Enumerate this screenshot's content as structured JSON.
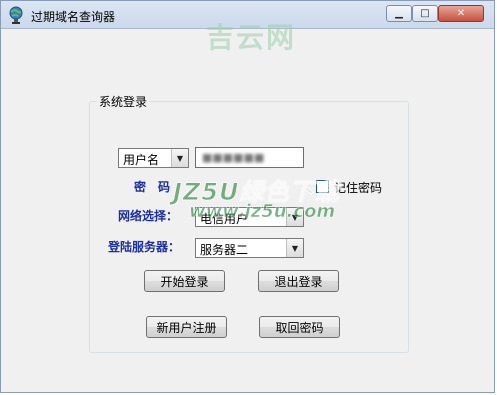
{
  "window": {
    "title": "过期域名查询器",
    "minimize_glyph": "▁",
    "maximize_glyph": "□",
    "close_glyph": "✕"
  },
  "watermark": {
    "top": "吉云网",
    "middle": "JZ5U绿色下载",
    "url": "www.jz5u.com"
  },
  "group": {
    "title": "系统登录"
  },
  "login": {
    "user_type": "用户名",
    "username_value": "■■■■■■",
    "password_label": "密　码",
    "remember_label": "记住密码",
    "network_label": "网络选择：",
    "network_value": "电信用户",
    "server_label": "登陆服务器：",
    "server_value": "服务器二"
  },
  "buttons": {
    "start_login": "开始登录",
    "exit_login": "退出登录",
    "register": "新用户注册",
    "recover_password": "取回密码"
  },
  "colors": {
    "label_blue": "#1c2fa3",
    "watermark_green": "#2e8a44",
    "window_bg": "#f0f0f0"
  }
}
